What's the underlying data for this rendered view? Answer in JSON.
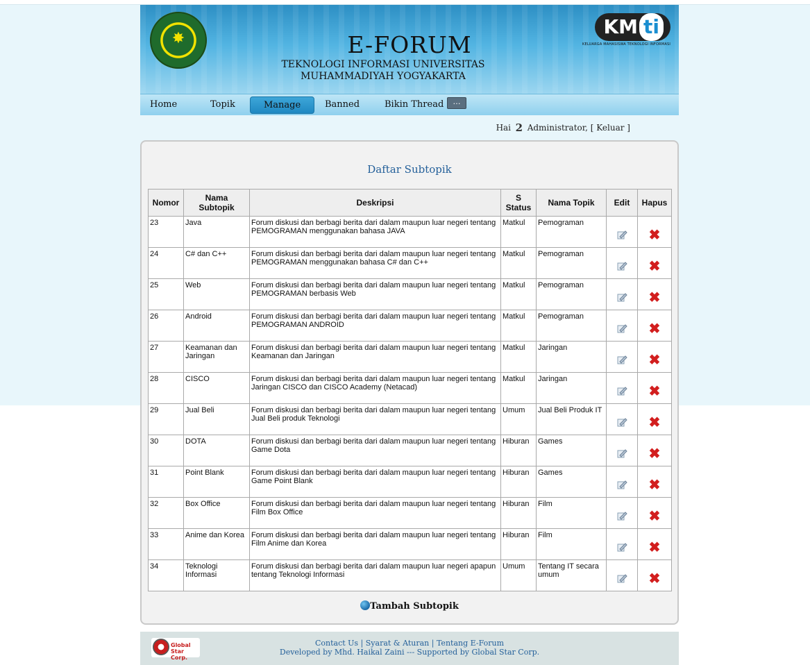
{
  "header": {
    "title": "E-FORUM",
    "subtitle": "TEKNOLOGI INFORMASI UNIVERSITAS MUHAMMADIYAH YOGYAKARTA",
    "kmti_tagline": "KELUARGA MAHASISWA TEKNOLOGI INFORMASI"
  },
  "nav": {
    "items": [
      {
        "label": "Home"
      },
      {
        "label": "Topik"
      },
      {
        "label": "Manage"
      },
      {
        "label": "Banned"
      },
      {
        "label": "Bikin Thread"
      }
    ],
    "more": "…"
  },
  "greeting": {
    "prefix": "Hai",
    "user": "Administrator,",
    "logout": "[ Keluar ]"
  },
  "panel": {
    "title": "Daftar Subtopik",
    "add_label": "Tambah Subtopik"
  },
  "table": {
    "headers": [
      "Nomor",
      "Nama Subtopik",
      "Deskripsi",
      "S Status",
      "Nama Topik",
      "Edit",
      "Hapus"
    ],
    "rows": [
      {
        "no": "23",
        "nama": "Java",
        "desc": "Forum diskusi dan berbagi berita dari dalam maupun luar negeri tentang PEMOGRAMAN menggunakan bahasa JAVA",
        "status": "Matkul",
        "topik": "Pemograman"
      },
      {
        "no": "24",
        "nama": "C# dan C++",
        "desc": "Forum diskusi dan berbagi berita dari dalam maupun luar negeri tentang PEMOGRAMAN menggunakan bahasa C# dan C++",
        "status": "Matkul",
        "topik": "Pemograman"
      },
      {
        "no": "25",
        "nama": "Web",
        "desc": "Forum diskusi dan berbagi berita dari dalam maupun luar negeri tentang PEMOGRAMAN berbasis Web",
        "status": "Matkul",
        "topik": "Pemograman"
      },
      {
        "no": "26",
        "nama": "Android",
        "desc": "Forum diskusi dan berbagi berita dari dalam maupun luar negeri tentang PEMOGRAMAN ANDROID",
        "status": "Matkul",
        "topik": "Pemograman"
      },
      {
        "no": "27",
        "nama": "Keamanan dan Jaringan",
        "desc": "Forum diskusi dan berbagi berita dari dalam maupun luar negeri tentang Keamanan dan Jaringan",
        "status": "Matkul",
        "topik": "Jaringan"
      },
      {
        "no": "28",
        "nama": "CISCO",
        "desc": "Forum diskusi dan berbagi berita dari dalam maupun luar negeri tentang Jaringan CISCO dan CISCO Academy (Netacad)",
        "status": "Matkul",
        "topik": "Jaringan"
      },
      {
        "no": "29",
        "nama": "Jual Beli",
        "desc": "Forum diskusi dan berbagi berita dari dalam maupun luar negeri tentang Jual Beli produk Teknologi",
        "status": "Umum",
        "topik": "Jual Beli Produk IT"
      },
      {
        "no": "30",
        "nama": "DOTA",
        "desc": "Forum diskusi dan berbagi berita dari dalam maupun luar negeri tentang Game Dota",
        "status": "Hiburan",
        "topik": "Games"
      },
      {
        "no": "31",
        "nama": "Point Blank",
        "desc": "Forum diskusi dan berbagi berita dari dalam maupun luar negeri tentang Game Point Blank",
        "status": "Hiburan",
        "topik": "Games"
      },
      {
        "no": "32",
        "nama": "Box Office",
        "desc": "Forum diskusi dan berbagi berita dari dalam maupun luar negeri tentang Film Box Office",
        "status": "Hiburan",
        "topik": "Film"
      },
      {
        "no": "33",
        "nama": "Anime dan Korea",
        "desc": "Forum diskusi dan berbagi berita dari dalam maupun luar negeri tentang Film Anime dan Korea",
        "status": "Hiburan",
        "topik": "Film"
      },
      {
        "no": "34",
        "nama": "Teknologi Informasi",
        "desc": "Forum diskusi dan berbagi berita dari dalam maupun luar negeri apapun tentang Teknologi Informasi",
        "status": "Umum",
        "topik": "Tentang IT secara umum"
      }
    ]
  },
  "footer": {
    "links": "Contact Us | Syarat & Aturan | Tentang E-Forum",
    "credit": "Developed by Mhd. Haikal Zaini --- Supported by Global Star Corp.",
    "logo_text": "Global Star Corp."
  },
  "colors": {
    "header_blue": "#3a9fd2",
    "title_blue": "#24609a",
    "delete_red": "#d21e1e"
  }
}
